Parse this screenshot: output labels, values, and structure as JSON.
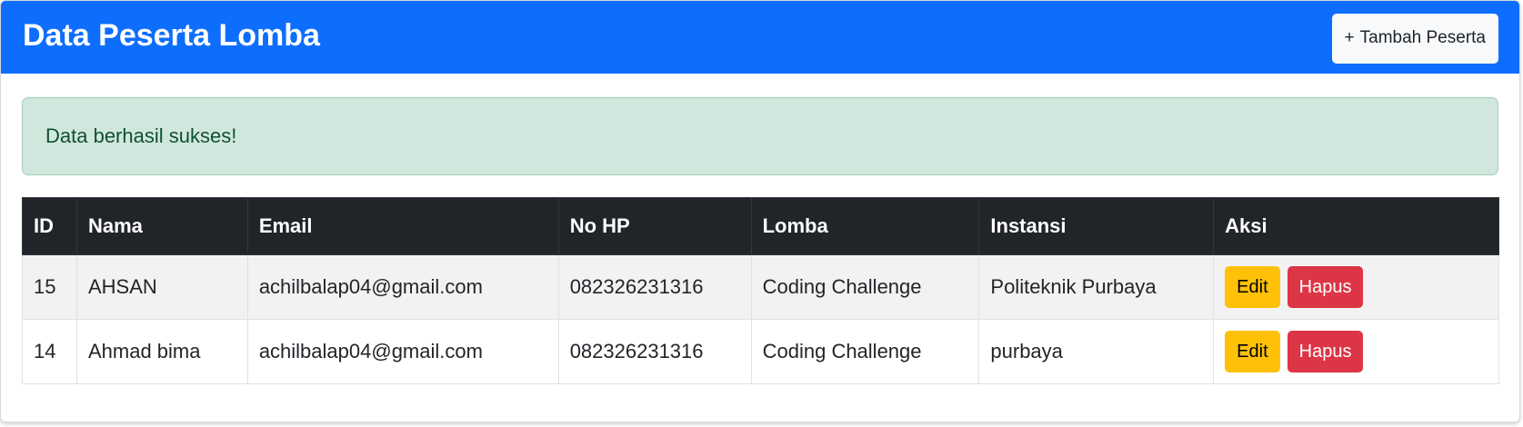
{
  "header": {
    "title": "Data Peserta Lomba",
    "add_icon": "plus-icon",
    "add_icon_glyph": "+",
    "add_label": "Tambah Peserta"
  },
  "alert": {
    "message": "Data berhasil sukses!"
  },
  "table": {
    "columns": [
      "ID",
      "Nama",
      "Email",
      "No HP",
      "Lomba",
      "Instansi",
      "Aksi"
    ],
    "rows": [
      {
        "id": "15",
        "nama": "AHSAN",
        "email": "achilbalap04@gmail.com",
        "no_hp": "082326231316",
        "lomba": "Coding Challenge",
        "instansi": "Politeknik Purbaya",
        "edit_label": "Edit",
        "delete_label": "Hapus"
      },
      {
        "id": "14",
        "nama": "Ahmad bima",
        "email": "achilbalap04@gmail.com",
        "no_hp": "082326231316",
        "lomba": "Coding Challenge",
        "instansi": "purbaya",
        "edit_label": "Edit",
        "delete_label": "Hapus"
      }
    ]
  },
  "colors": {
    "primary": "#0d6efd",
    "success_bg": "#d1e7dd",
    "success_text": "#0f5132",
    "table_head": "#212529",
    "warning": "#ffc107",
    "danger": "#dc3545"
  }
}
